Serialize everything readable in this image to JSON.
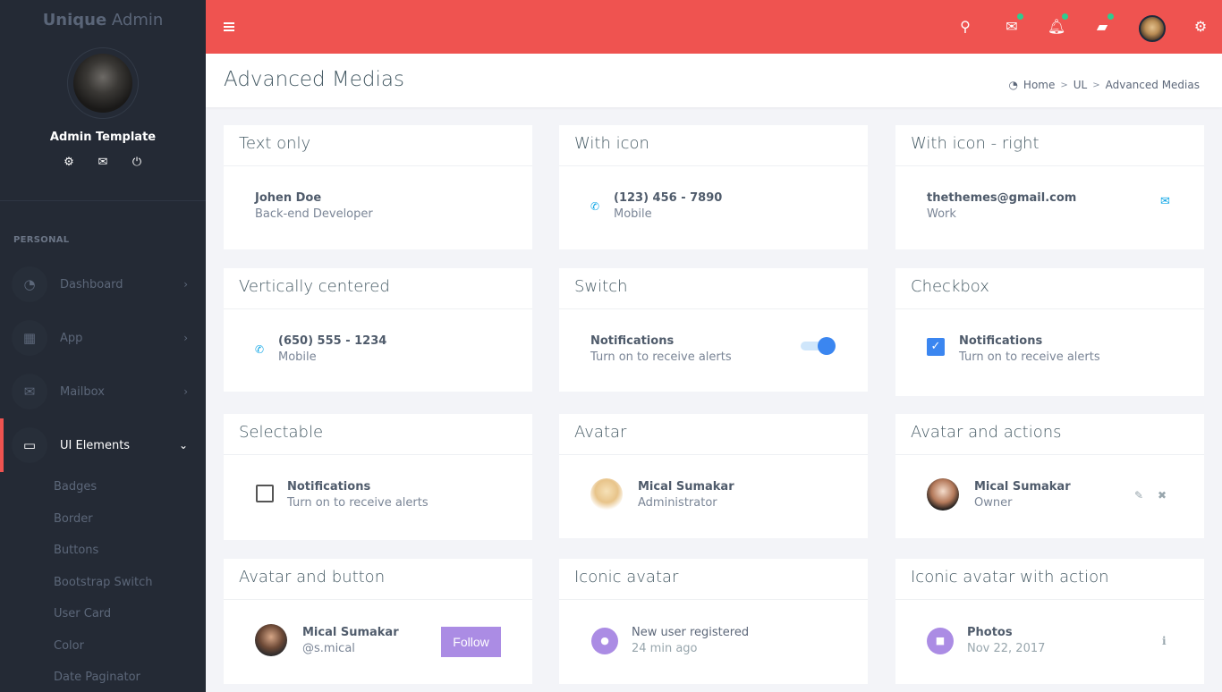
{
  "brand": {
    "bold": "Unique",
    "light": " Admin"
  },
  "profile": {
    "name": "Admin Template",
    "actions": [
      "gear-icon",
      "mail-icon",
      "power-icon"
    ]
  },
  "sidebar": {
    "section": "PERSONAL",
    "items": [
      {
        "label": "Dashboard",
        "icon": "dashboard-icon",
        "glyph": "◔",
        "chevron": "›"
      },
      {
        "label": "App",
        "icon": "grid-icon",
        "glyph": "▦",
        "chevron": "›"
      },
      {
        "label": "Mailbox",
        "icon": "mail-icon",
        "glyph": "✉",
        "chevron": "›"
      },
      {
        "label": "UI Elements",
        "icon": "laptop-icon",
        "glyph": "▭",
        "chevron": "⌄",
        "active": true
      }
    ],
    "subitems": [
      "Badges",
      "Border",
      "Buttons",
      "Bootstrap Switch",
      "User Card",
      "Color",
      "Date Paginator"
    ]
  },
  "topbar": {
    "accent": "#ef5350",
    "notification_dot": "#2ecc8f"
  },
  "page": {
    "title": "Advanced Medias"
  },
  "breadcrumb": [
    "Home",
    "UL",
    "Advanced Medias"
  ],
  "cards": {
    "text_only": {
      "title": "Text only",
      "name": "Johen Doe",
      "sub": "Back-end Developer"
    },
    "with_icon": {
      "title": "With icon",
      "name": "(123) 456 - 7890",
      "sub": "Mobile"
    },
    "with_icon_right": {
      "title": "With icon - right",
      "name": "thethemes@gmail.com",
      "sub": "Work"
    },
    "vertically_centered": {
      "title": "Vertically centered",
      "name": "(650) 555 - 1234",
      "sub": "Mobile"
    },
    "switch": {
      "title": "Switch",
      "name": "Notifications",
      "sub": "Turn on to receive alerts",
      "on": true
    },
    "checkbox": {
      "title": "Checkbox",
      "name": "Notifications",
      "sub": "Turn on to receive alerts",
      "checked": true
    },
    "selectable": {
      "title": "Selectable",
      "name": "Notifications",
      "sub": "Turn on to receive alerts",
      "checked": false
    },
    "avatar": {
      "title": "Avatar",
      "name": "Mical Sumakar",
      "sub": "Administrator"
    },
    "avatar_actions": {
      "title": "Avatar and actions",
      "name": "Mical Sumakar",
      "sub": "Owner"
    },
    "avatar_button": {
      "title": "Avatar and button",
      "name": "Mical Sumakar",
      "sub": "@s.mical",
      "button": "Follow"
    },
    "iconic_avatar": {
      "title": "Iconic avatar",
      "name": "New user registered",
      "sub": "24 min ago"
    },
    "iconic_avatar_action": {
      "title": "Iconic avatar with action",
      "name": "Photos",
      "sub": "Nov 22, 2017"
    }
  },
  "colors": {
    "primary": "#3b86f0",
    "purple": "#ab8ce4",
    "info": "#0fa6e6",
    "sidebar_bg": "#242a35"
  }
}
